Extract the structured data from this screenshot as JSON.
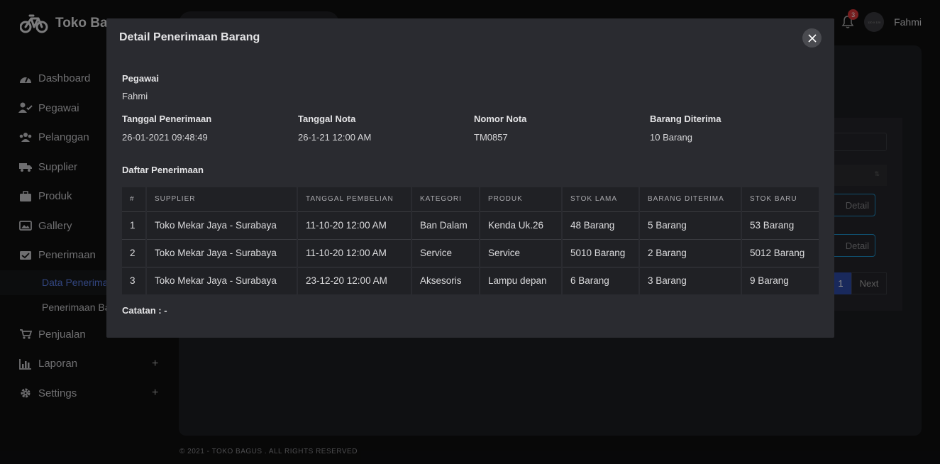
{
  "app": {
    "brand": "Toko Bagus"
  },
  "topbar": {
    "notification_count": "3",
    "avatar_text": "120 X 120",
    "user_name": "Fahmi"
  },
  "sidebar": {
    "items": [
      {
        "label": "Dashboard",
        "icon": "gauge-icon"
      },
      {
        "label": "Pegawai",
        "icon": "user-check-icon"
      },
      {
        "label": "Pelanggan",
        "icon": "users-icon"
      },
      {
        "label": "Supplier",
        "icon": "truck-icon"
      },
      {
        "label": "Produk",
        "icon": "briefcase-icon"
      },
      {
        "label": "Gallery",
        "icon": "image-icon"
      },
      {
        "label": "Penerimaan",
        "icon": "inbox-icon"
      }
    ],
    "sub_items": [
      "Data Penerimaan",
      "Penerimaan Barang"
    ],
    "items_after": [
      {
        "label": "Penjualan",
        "icon": "cart-icon"
      },
      {
        "label": "Laporan",
        "icon": "bar-chart-icon"
      },
      {
        "label": "Settings",
        "icon": "gear-icon"
      }
    ]
  },
  "background": {
    "detail_label": "Detail",
    "page_number": "1",
    "next_label": "Next",
    "sort_mark": "⇅"
  },
  "footer": {
    "text": "© 2021 - TOKO BAGUS . ALL RIGHTS RESERVED"
  },
  "modal": {
    "title": "Detail Penerimaan Barang",
    "pegawai_label": "Pegawai",
    "pegawai_value": "Fahmi",
    "tanggal_penerimaan_label": "Tanggal Penerimaan",
    "tanggal_penerimaan_value": "26-01-2021 09:48:49",
    "tanggal_nota_label": "Tanggal Nota",
    "tanggal_nota_value": "26-1-21 12:00 AM",
    "nomor_nota_label": "Nomor Nota",
    "nomor_nota_value": "TM0857",
    "barang_diterima_label": "Barang Diterima",
    "barang_diterima_value": "10 Barang",
    "daftar_label": "Daftar Penerimaan",
    "catatan": "Catatan : -",
    "columns": [
      "#",
      "SUPPLIER",
      "TANGGAL PEMBELIAN",
      "KATEGORI",
      "PRODUK",
      "STOK LAMA",
      "BARANG DITERIMA",
      "STOK BARU"
    ],
    "rows": [
      [
        "1",
        "Toko Mekar Jaya - Surabaya",
        "11-10-20 12:00 AM",
        "Ban Dalam",
        "Kenda Uk.26",
        "48 Barang",
        "5 Barang",
        "53 Barang"
      ],
      [
        "2",
        "Toko Mekar Jaya - Surabaya",
        "11-10-20 12:00 AM",
        "Service",
        "Service",
        "5010 Barang",
        "2 Barang",
        "5012 Barang"
      ],
      [
        "3",
        "Toko Mekar Jaya - Surabaya",
        "23-12-20 12:00 AM",
        "Aksesoris",
        "Lampu depan",
        "6 Barang",
        "3 Barang",
        "9 Barang"
      ]
    ]
  },
  "colors": {
    "accent": "#5b7fe8",
    "badge": "#d9383a",
    "modal_bg": "#2a2b30",
    "detail_border": "#1e8fc6"
  }
}
